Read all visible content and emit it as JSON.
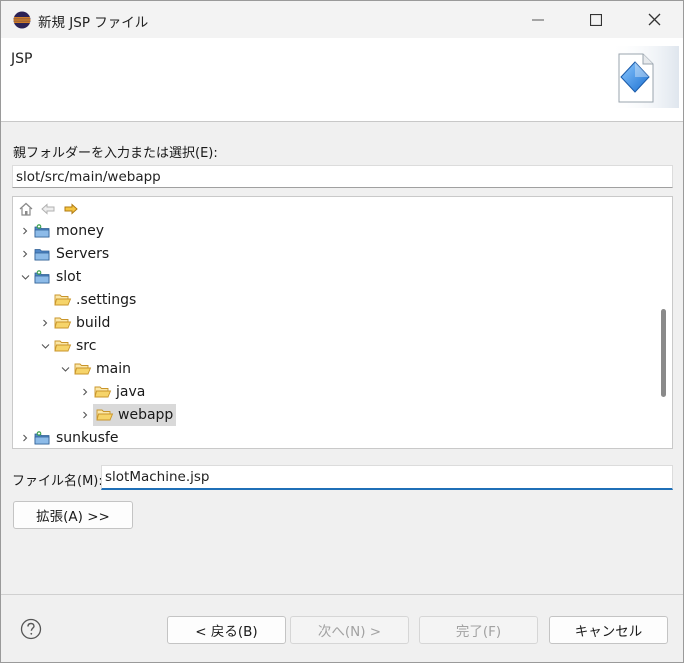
{
  "window": {
    "title": "新規 JSP ファイル",
    "icon": "eclipse-icon"
  },
  "banner": {
    "title": "JSP",
    "image": "jsp-wizard-banner-icon"
  },
  "folder": {
    "label": "親フォルダーを入力または選択(E):",
    "value": "slot/src/main/webapp"
  },
  "tree": {
    "toolbar": [
      "home-icon",
      "back-arrow-icon",
      "forward-arrow-icon"
    ],
    "items": [
      {
        "label": "money",
        "type": "project",
        "expand": "collapsed"
      },
      {
        "label": "Servers",
        "type": "folder",
        "expand": "collapsed"
      },
      {
        "label": "slot",
        "type": "project",
        "expand": "expanded"
      },
      {
        "label": ".settings",
        "type": "folder",
        "expand": "none"
      },
      {
        "label": "build",
        "type": "folder",
        "expand": "collapsed"
      },
      {
        "label": "src",
        "type": "folder-open",
        "expand": "expanded"
      },
      {
        "label": "main",
        "type": "folder-open",
        "expand": "expanded"
      },
      {
        "label": "java",
        "type": "folder-open",
        "expand": "collapsed"
      },
      {
        "label": "webapp",
        "type": "folder-open",
        "expand": "collapsed",
        "selected": true
      },
      {
        "label": "sunkusfe",
        "type": "project",
        "expand": "collapsed"
      }
    ]
  },
  "file": {
    "label": "ファイル名(M):",
    "value": "slotMachine.jsp"
  },
  "buttons": {
    "advanced": "拡張(A) >>",
    "back": "< 戻る(B)",
    "next": "次へ(N) >",
    "finish": "完了(F)",
    "cancel": "キャンセル"
  },
  "colors": {
    "accent": "#1f6fb7",
    "folder": "#e8b84a",
    "selection": "#d9d9d9"
  }
}
